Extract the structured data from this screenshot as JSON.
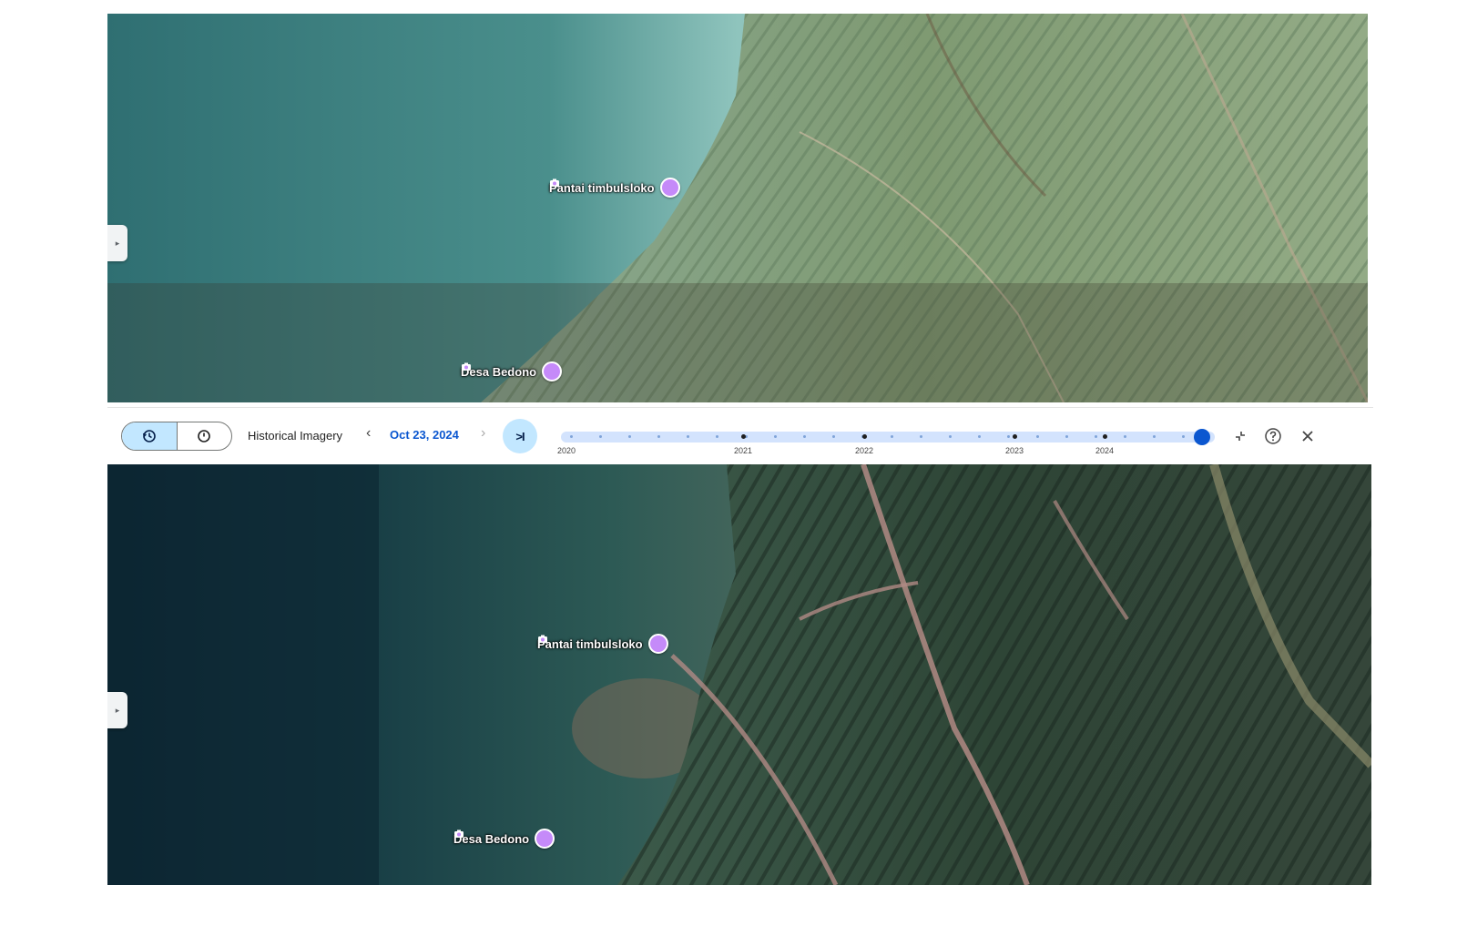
{
  "top_map": {
    "places": [
      {
        "label": "Pantai timbulsloko"
      },
      {
        "label": "Desa Bedono"
      }
    ],
    "panel_tab_glyph": "▸"
  },
  "bottom_map": {
    "places": [
      {
        "label": "Pantai timbulsloko"
      },
      {
        "label": "Desa Bedono"
      }
    ],
    "panel_tab_glyph": "▸"
  },
  "toolbar": {
    "history_icon": "history-icon",
    "clock_icon": "clock-icon",
    "label": "Historical Imagery",
    "prev_glyph": "‹",
    "date": "Oct 23, 2024",
    "next_glyph": "›",
    "latest_label": ">I",
    "timeline_years": [
      "2020",
      "2021",
      "2022",
      "2023",
      "2024"
    ],
    "timeline_position_fraction": 0.98,
    "collapse_icon": "collapse-icon",
    "help_icon": "help-icon",
    "close_icon": "close-icon"
  },
  "colors": {
    "accent": "#0b57d0",
    "selected_bg": "#c2e7ff",
    "pin": "#c58af9"
  }
}
